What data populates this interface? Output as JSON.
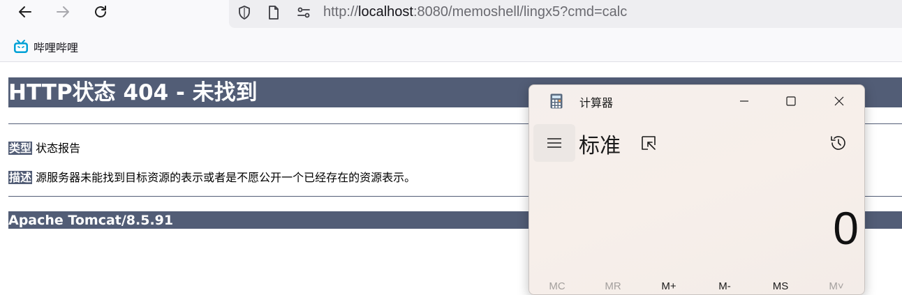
{
  "browser": {
    "url_prefix": "http://",
    "url_host": "localhost",
    "url_rest": ":8080/memoshell/lingx5?cmd=calc",
    "bookmark_label": "哔哩哔哩",
    "icons": [
      "back-arrow-icon",
      "forward-arrow-icon",
      "reload-icon",
      "shield-icon",
      "page-icon",
      "permissions-icon",
      "bilibili-icon"
    ]
  },
  "page": {
    "heading": "HTTP状态 404 - 未找到",
    "type_label": "类型",
    "type_value": "状态报告",
    "desc_label": "描述",
    "desc_value": "源服务器未能找到目标资源的表示或者是不愿公开一个已经存在的资源表示。",
    "footer": "Apache Tomcat/8.5.91",
    "header_color": "#525d76"
  },
  "calculator": {
    "title": "计算器",
    "mode": "标准",
    "display": "0",
    "memory_buttons": [
      {
        "label": "MC",
        "enabled": false
      },
      {
        "label": "MR",
        "enabled": false
      },
      {
        "label": "M+",
        "enabled": true
      },
      {
        "label": "M-",
        "enabled": true
      },
      {
        "label": "MS",
        "enabled": true
      },
      {
        "label": "M˅",
        "enabled": false
      }
    ],
    "icons": [
      "calculator-icon",
      "minimize-icon",
      "maximize-icon",
      "close-icon",
      "hamburger-menu-icon",
      "keep-on-top-icon",
      "history-icon"
    ]
  }
}
